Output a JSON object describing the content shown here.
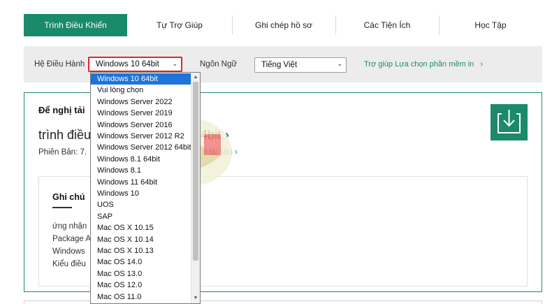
{
  "nav": {
    "tabs": [
      {
        "label": "Trình Điều Khiển",
        "active": true
      },
      {
        "label": "Tự Trợ Giúp"
      },
      {
        "label": "Ghi chép hồ sơ"
      },
      {
        "label": "Các Tiện Ích"
      },
      {
        "label": "Học Tập"
      }
    ]
  },
  "filters": {
    "os_label": "Hệ Điều Hành",
    "os_value": "Windows 10 64bit",
    "language_label": "Ngôn Ngữ",
    "language_value": "Tiếng Việt",
    "help_link": "Trợ giúp Lựa chọn phần mềm in",
    "help_arrow": "›",
    "select_chevron": "⌄"
  },
  "download": {
    "title": "Để nghị tải",
    "driver_name": "trình điều",
    "driver_name_suffix": "4bit",
    "driver_arrow": "›",
    "version_label": "Phiên Bản: 7.",
    "docs_link": "n tài liệu ›",
    "download_icon": "download-icon"
  },
  "notes": {
    "title": "Ghi chú",
    "lines": [
      "ứng nhận",
      "Package A",
      "Windows",
      "Kiểu điều"
    ]
  },
  "os_dropdown": {
    "options": [
      "Windows 10 64bit",
      "Vui lòng chọn",
      "Windows Server 2022",
      "Windows Server 2019",
      "Windows Server 2016",
      "Windows Server 2012 R2",
      "Windows Server 2012 64bit",
      "Windows 8.1 64bit",
      "Windows 8.1",
      "Windows 11 64bit",
      "Windows 10",
      "UOS",
      "SAP",
      "Mac OS X 10.15",
      "Mac OS X 10.14",
      "Mac OS X 10.13",
      "Mac OS 14.0",
      "Mac OS 13.0",
      "Mac OS 12.0",
      "Mac OS 11.0"
    ],
    "selected_index": 0,
    "scroll_up": "▲",
    "scroll_down": "▼"
  },
  "colors": {
    "accent": "#1a8a6b",
    "highlight": "#e3262b",
    "selected": "#1e74d8"
  }
}
